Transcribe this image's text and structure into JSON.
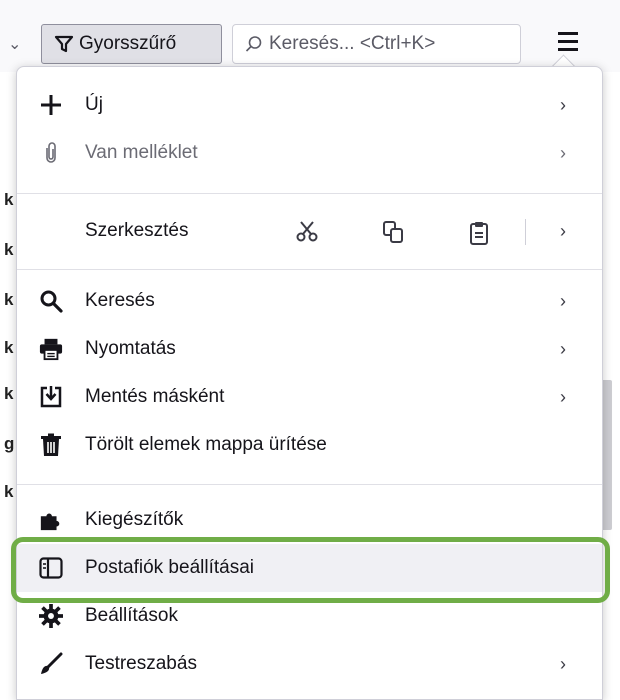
{
  "toolbar": {
    "quickfilter_label": "Gyorsszűrő",
    "search_placeholder": "Keresés... <Ctrl+K>"
  },
  "background": {
    "letters": [
      "k",
      "k",
      "k",
      "k",
      "k",
      "g",
      "k"
    ]
  },
  "menu": {
    "new": {
      "label": "Új",
      "icon": "plus-icon"
    },
    "attachment": {
      "label": "Van melléklet",
      "icon": "paperclip-icon"
    },
    "edit": {
      "label": "Szerkesztés",
      "tools": [
        "scissors-icon",
        "copy-icon",
        "paste-icon"
      ]
    },
    "find": {
      "label": "Keresés",
      "icon": "search-icon"
    },
    "print": {
      "label": "Nyomtatás",
      "icon": "printer-icon"
    },
    "save_as": {
      "label": "Mentés másként",
      "icon": "save-as-icon"
    },
    "empty_trash": {
      "label": "Törölt elemek mappa ürítése",
      "icon": "trash-icon"
    },
    "addons": {
      "label": "Kiegészítők",
      "icon": "puzzle-icon"
    },
    "account_settings": {
      "label": "Postafiók beállításai",
      "icon": "account-settings-icon"
    },
    "settings": {
      "label": "Beállítások",
      "icon": "gear-icon"
    },
    "customize": {
      "label": "Testreszabás",
      "icon": "brush-icon"
    }
  },
  "colors": {
    "highlight_ring": "#70ad47",
    "menu_bg": "#ffffff",
    "text": "#15141a"
  }
}
